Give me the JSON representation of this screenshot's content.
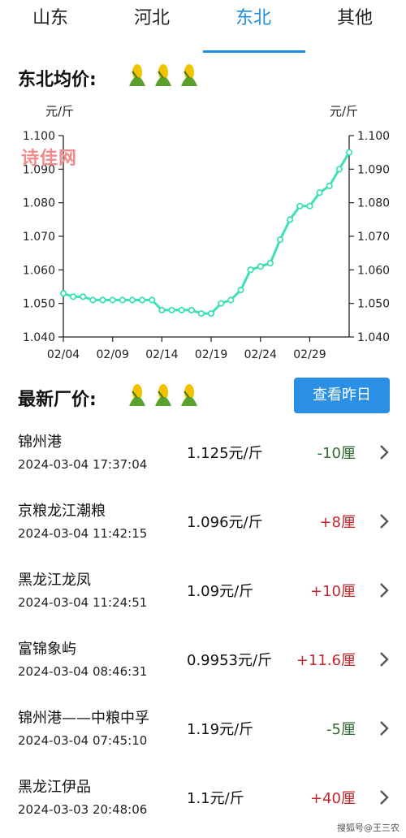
{
  "tabs": [
    "山东",
    "河北",
    "东北",
    "其他"
  ],
  "active_tab": 2,
  "avg_section": {
    "title": "东北均价:"
  },
  "chart_data": {
    "type": "line",
    "unit_left": "元/斤",
    "unit_right": "元/斤",
    "ylim": [
      1.04,
      1.1
    ],
    "yticks": [
      "1.100",
      "1.090",
      "1.080",
      "1.070",
      "1.060",
      "1.050",
      "1.040"
    ],
    "xticks": [
      "02/04",
      "02/09",
      "02/14",
      "02/19",
      "02/24",
      "02/29"
    ],
    "xtick_index": [
      0,
      5,
      10,
      15,
      20,
      25
    ],
    "values": [
      1.053,
      1.052,
      1.052,
      1.051,
      1.051,
      1.051,
      1.051,
      1.051,
      1.051,
      1.051,
      1.048,
      1.048,
      1.048,
      1.048,
      1.047,
      1.047,
      1.05,
      1.051,
      1.054,
      1.06,
      1.061,
      1.062,
      1.069,
      1.075,
      1.079,
      1.079,
      1.083,
      1.085,
      1.09,
      1.095
    ],
    "series_color": "#3fe0b8",
    "grid": false
  },
  "watermark": "诗佳网",
  "latest_section": {
    "title": "最新厂价:",
    "button": "查看昨日"
  },
  "rows": [
    {
      "name": "锦州港",
      "time": "2024-03-04 17:37:04",
      "price": "1.125元/斤",
      "change": "-10厘",
      "dir": "down"
    },
    {
      "name": "京粮龙江潮粮",
      "time": "2024-03-04 11:42:15",
      "price": "1.096元/斤",
      "change": "+8厘",
      "dir": "up"
    },
    {
      "name": "黑龙江龙凤",
      "time": "2024-03-04 11:24:51",
      "price": "1.09元/斤",
      "change": "+10厘",
      "dir": "up"
    },
    {
      "name": "富锦象屿",
      "time": "2024-03-04 08:46:31",
      "price": "0.9953元/斤",
      "change": "+11.6厘",
      "dir": "up"
    },
    {
      "name": "锦州港——中粮中孚",
      "time": "2024-03-04 07:45:10",
      "price": "1.19元/斤",
      "change": "-5厘",
      "dir": "down"
    },
    {
      "name": "黑龙江伊品",
      "time": "2024-03-03 20:48:06",
      "price": "1.1元/斤",
      "change": "+40厘",
      "dir": "up"
    }
  ],
  "colors": {
    "up": "#c0272d",
    "down": "#2e6b2e",
    "accent": "#1f8de0"
  },
  "footer_watermark": "搜狐号@王三农"
}
